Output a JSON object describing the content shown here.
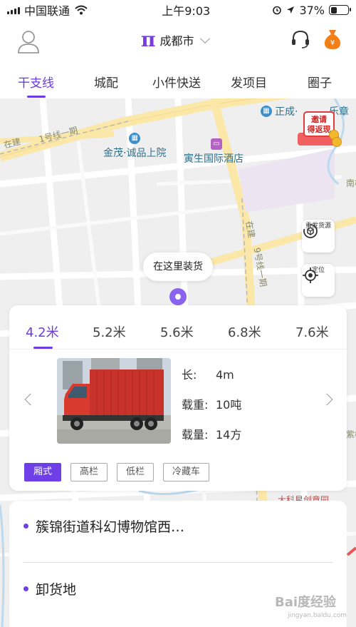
{
  "status_bar": {
    "carrier": "中国联通",
    "time": "上午9:03",
    "battery": "37%",
    "battery_level": 0.37
  },
  "header": {
    "brand_logo": "π",
    "city": "成都市"
  },
  "tabs": [
    {
      "label": "干支线",
      "active": true
    },
    {
      "label": "城配",
      "active": false
    },
    {
      "label": "小件快送",
      "active": false
    },
    {
      "label": "发项目",
      "active": false
    },
    {
      "label": "圈子",
      "active": false
    }
  ],
  "map": {
    "pois": [
      {
        "label": "金茂·诚品上院",
        "icon": "building-icon"
      },
      {
        "label": "寅生国际酒店",
        "icon": "hotel-icon"
      },
      {
        "label": "正成·",
        "icon": "building-icon"
      },
      {
        "label": "乐章",
        "icon": ""
      }
    ],
    "streets": [
      "在建",
      "1号线一期",
      "在建",
      "9号线一期",
      "大科星创意园",
      "紫檀",
      "南桥"
    ],
    "invite": {
      "line1": "邀请",
      "line2": "得返现"
    },
    "controls": [
      {
        "label": "重发货源",
        "icon": "refresh-cargo-icon"
      },
      {
        "label": "定位",
        "icon": "locate-icon"
      }
    ],
    "pickup_bubble": "在这里装货"
  },
  "vehicle": {
    "sizes": [
      {
        "label": "4.2米",
        "active": true
      },
      {
        "label": "5.2米",
        "active": false
      },
      {
        "label": "5.6米",
        "active": false
      },
      {
        "label": "6.8米",
        "active": false
      },
      {
        "label": "7.6米",
        "active": false
      }
    ],
    "specs": [
      {
        "key": "长:",
        "value": "4m"
      },
      {
        "key": "载重:",
        "value": "10吨"
      },
      {
        "key": "载量:",
        "value": "14方"
      }
    ],
    "types": [
      {
        "label": "厢式",
        "active": true
      },
      {
        "label": "高栏",
        "active": false
      },
      {
        "label": "低栏",
        "active": false
      },
      {
        "label": "冷藏车",
        "active": false
      }
    ]
  },
  "address": {
    "pickup": "簇锦街道科幻博物馆西…",
    "dropoff": "卸货地"
  },
  "watermark": {
    "text": "Bai度经验",
    "sub": "jingyan.baidu.com"
  },
  "colors": {
    "accent": "#6a3be0",
    "pin": "#8a64ef",
    "map_bg": "#efefef",
    "road_major": "#fbe7a8"
  }
}
